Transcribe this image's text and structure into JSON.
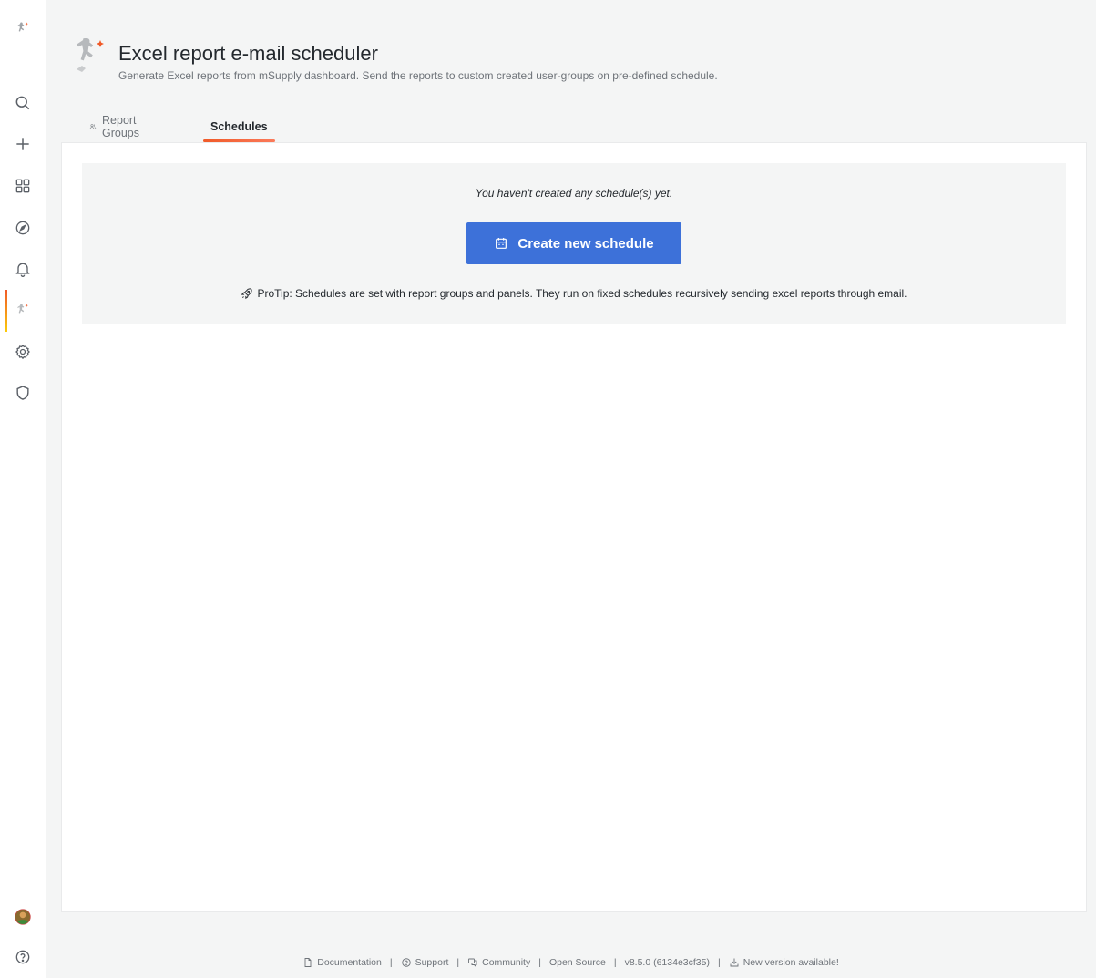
{
  "sidebar": {
    "top": [
      {
        "name": "app-logo-icon"
      },
      {
        "name": "search-icon"
      },
      {
        "name": "plus-icon"
      },
      {
        "name": "dashboards-icon"
      },
      {
        "name": "compass-icon"
      },
      {
        "name": "bell-icon"
      },
      {
        "name": "msupply-app-icon",
        "active": true
      },
      {
        "name": "gear-icon"
      },
      {
        "name": "shield-icon"
      }
    ],
    "bottom": [
      {
        "name": "user-avatar"
      },
      {
        "name": "help-icon"
      }
    ]
  },
  "header": {
    "title": "Excel report e-mail scheduler",
    "subtitle": "Generate Excel reports from mSupply dashboard. Send the reports to custom created user-groups on pre-defined schedule."
  },
  "tabs": [
    {
      "label": "Report Groups",
      "icon": "users-icon",
      "active": false
    },
    {
      "label": "Schedules",
      "active": true
    }
  ],
  "empty_state": {
    "message": "You haven't created any schedule(s) yet.",
    "button_label": "Create new schedule",
    "button_icon": "calendar-icon",
    "protip_icon": "rocket-icon",
    "protip": "ProTip: Schedules are set with report groups and panels. They run on fixed schedules recursively sending excel reports through email."
  },
  "footer": {
    "documentation": "Documentation",
    "support": "Support",
    "community": "Community",
    "open_source": "Open Source",
    "version": "v8.5.0 (6134e3cf35)",
    "new_version": "New version available!"
  },
  "colors": {
    "accent": "#f05a28",
    "primary_button": "#3d71d9",
    "background": "#f4f5f5"
  }
}
